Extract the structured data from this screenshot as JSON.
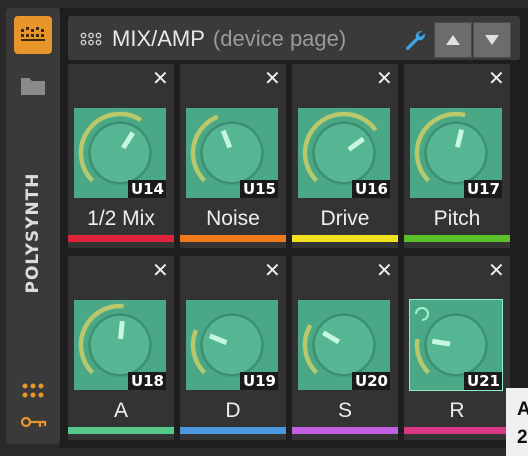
{
  "sidebar": {
    "vertical_label": "POLYSYNTH",
    "icons": [
      "synth-icon",
      "folder-icon",
      "dots-grid-icon",
      "key-icon"
    ]
  },
  "header": {
    "title": "MIX/AMP",
    "subtitle": "(device page)",
    "icons": [
      "grid-icon",
      "wrench-icon",
      "arrow-up-icon",
      "arrow-down-icon"
    ]
  },
  "macros": [
    {
      "name": "1/2 Mix",
      "ulabel": "U14",
      "value": 0.62,
      "color": "#e0223a"
    },
    {
      "name": "Noise",
      "ulabel": "U15",
      "value": 0.42,
      "color": "#f07a18"
    },
    {
      "name": "Drive",
      "ulabel": "U16",
      "value": 0.7,
      "color": "#f0e020"
    },
    {
      "name": "Pitch",
      "ulabel": "U17",
      "value": 0.55,
      "color": "#5cc02a"
    },
    {
      "name": "A",
      "ulabel": "U18",
      "value": 0.52,
      "color": "#55c98a"
    },
    {
      "name": "D",
      "ulabel": "U19",
      "value": 0.25,
      "color": "#4a98e0"
    },
    {
      "name": "S",
      "ulabel": "U20",
      "value": 0.28,
      "color": "#c060e0"
    },
    {
      "name": "R",
      "ulabel": "U21",
      "value": 0.2,
      "color": "#d83884",
      "selected": true
    }
  ],
  "close_glyph": "✕",
  "tooltip": {
    "line1": "A",
    "line2": "2"
  },
  "colors": {
    "accent": "#e8952a",
    "knob_bg": "#4aa886",
    "knob_arc": "#b8c86a"
  }
}
